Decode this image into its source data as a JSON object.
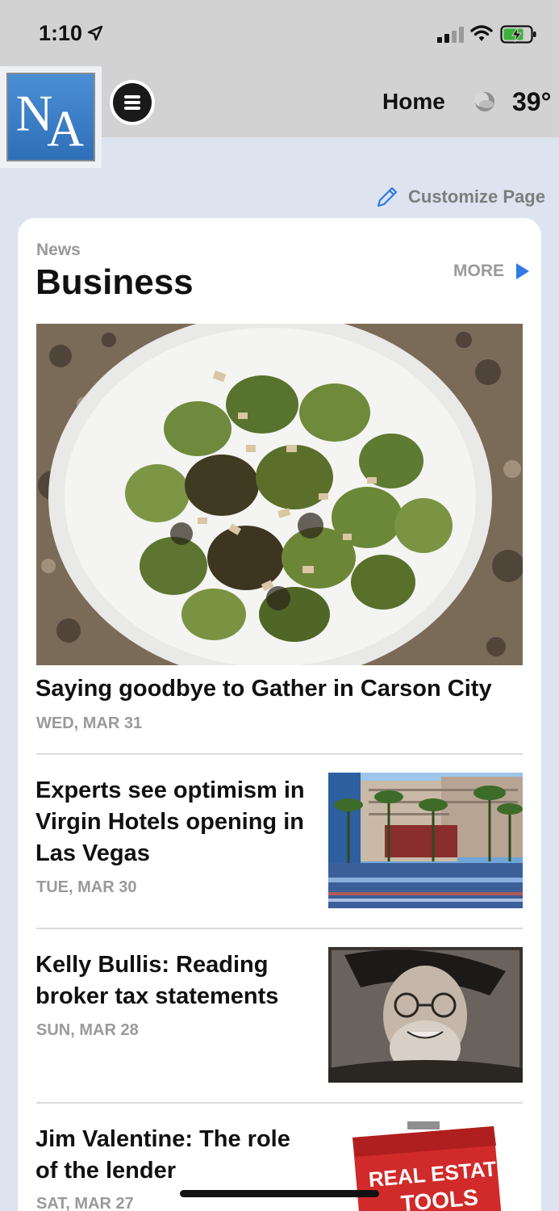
{
  "status_bar": {
    "time": "1:10"
  },
  "header": {
    "logo_text": "NA",
    "home_label": "Home",
    "temperature": "39°"
  },
  "customize": {
    "label": "Customize Page"
  },
  "section": {
    "kicker": "News",
    "title": "Business",
    "more_label": "MORE"
  },
  "hero": {
    "headline": "Saying goodbye to Gather in Carson City",
    "date": "WED, MAR 31"
  },
  "stories": [
    {
      "title": "Experts see optimism in Virgin Hotels opening in Las Vegas",
      "date": "TUE, MAR 30"
    },
    {
      "title": "Kelly Bullis: Reading broker tax statements",
      "date": "SUN, MAR 28"
    },
    {
      "title": "Jim Valentine:  The role of the lender",
      "date": "SAT, MAR 27",
      "thumb_text_1": "REAL ESTATE",
      "thumb_text_2": "TOOLS"
    }
  ],
  "colors": {
    "accent": "#2f7ae5",
    "header_bg": "#d2d2d2",
    "page_bg": "#dde3ef"
  }
}
